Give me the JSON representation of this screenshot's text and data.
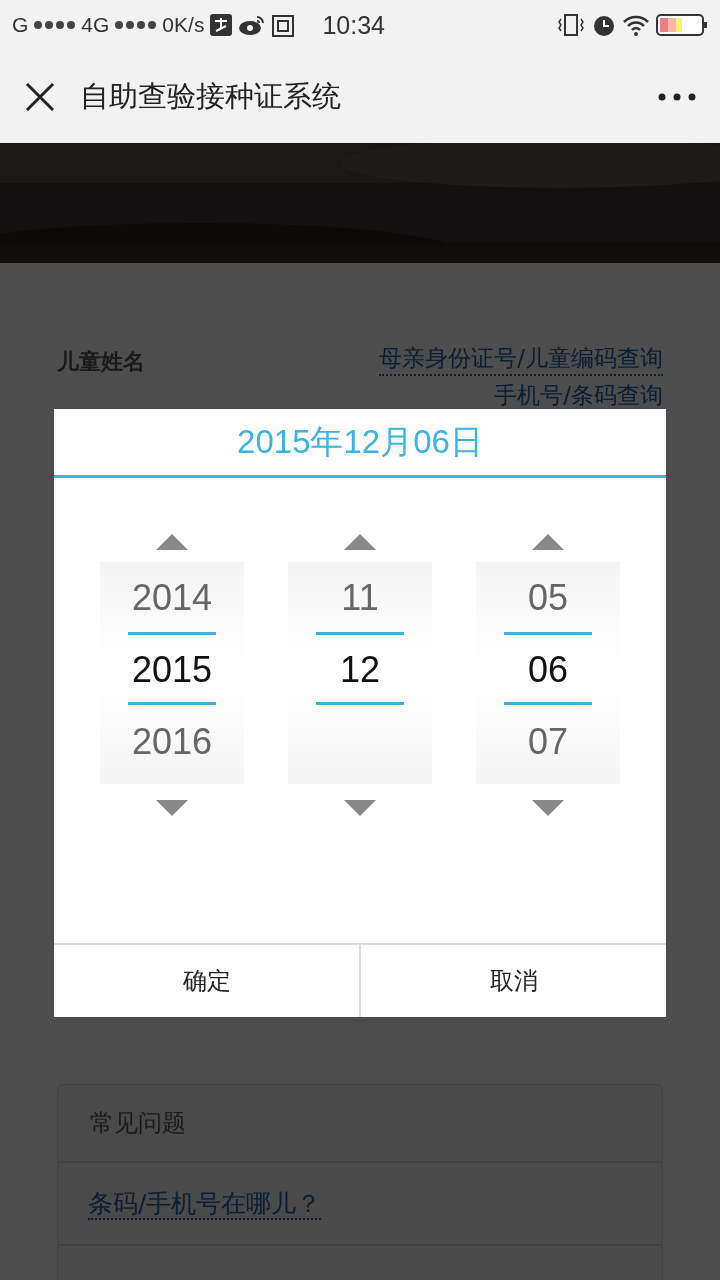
{
  "status_bar": {
    "carrier": "G",
    "network": "4G",
    "speed": "0K/s",
    "time": "10:34"
  },
  "nav_bar": {
    "title": "自助查验接种证系统"
  },
  "form": {
    "label": "儿童姓名",
    "links": [
      "母亲身份证号/儿童编码查询",
      "手机号/条码查询"
    ]
  },
  "date_picker": {
    "title": "2015年12月06日",
    "columns": [
      {
        "items": [
          {
            "text": "2014",
            "selected": false
          },
          {
            "text": "2015",
            "selected": true
          },
          {
            "text": "2016",
            "selected": false
          }
        ]
      },
      {
        "items": [
          {
            "text": "11",
            "selected": false
          },
          {
            "text": "12",
            "selected": true
          }
        ]
      },
      {
        "items": [
          {
            "text": "05",
            "selected": false
          },
          {
            "text": "06",
            "selected": true
          },
          {
            "text": "07",
            "selected": false
          }
        ]
      }
    ],
    "buttons": [
      "确定",
      "取消"
    ]
  },
  "faq": {
    "title": "常见问题",
    "items": [
      "条码/手机号在哪儿？"
    ]
  }
}
